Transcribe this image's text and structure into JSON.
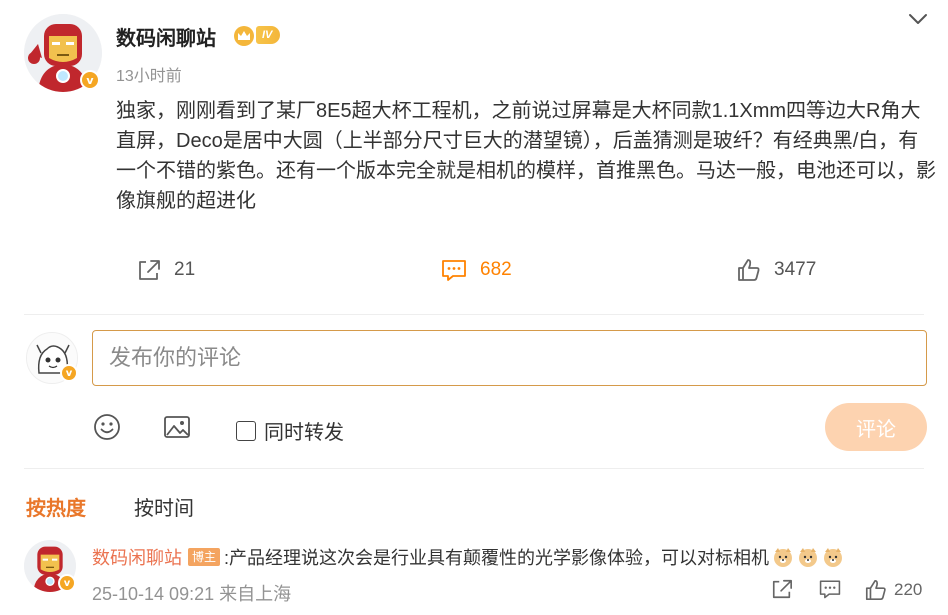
{
  "post": {
    "author": "数码闲聊站",
    "level_badge": "IV",
    "verified_badge": "v",
    "time": "13小时前",
    "text": "独家，刚刚看到了某厂8E5超大杯工程机，之前说过屏幕是大杯同款1.1Xmm四等边大R角大直屏，Deco是居中大圆（上半部分尺寸巨大的潜望镜），后盖猜测是玻纤？有经典黑/白，有一个不错的紫色。还有一个版本完全就是相机的模样，首推黑色。马达一般，电池还可以，影像旗舰的超进化",
    "actions": {
      "repost_count": "21",
      "comment_count": "682",
      "like_count": "3477"
    }
  },
  "composer": {
    "placeholder": "发布你的评论",
    "repost_label": "同时转发",
    "submit_label": "评论"
  },
  "sort_tabs": {
    "hot": "按热度",
    "time": "按时间"
  },
  "comments": [
    {
      "author": "数码闲聊站",
      "owner_tag": "博主",
      "text": ":产品经理说这次会是行业具有颠覆性的光学影像体验，可以对标相机",
      "meta": "25-10-14 09:21 来自上海",
      "like_count": "220"
    }
  ],
  "icons": {
    "expand": "chevron-down-icon",
    "repost": "share-icon",
    "comment": "comment-icon",
    "like": "thumbs-up-icon",
    "emoji": "smiley-icon",
    "image": "image-icon"
  },
  "colors": {
    "accent": "#ff8200",
    "tab_active": "#e9772a",
    "author_link": "#eb7350",
    "submit_disabled": "#fdd3b0",
    "input_border": "#d59a4a"
  }
}
